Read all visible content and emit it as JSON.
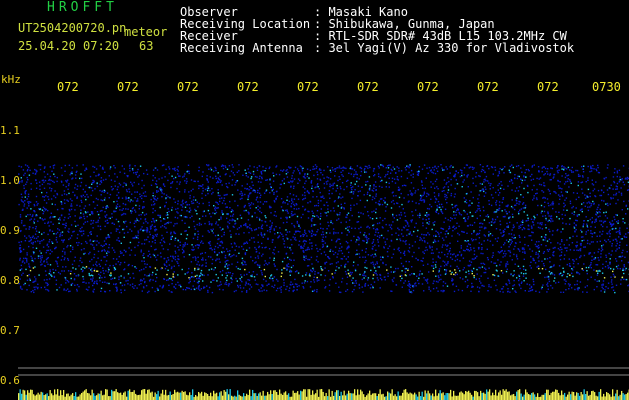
{
  "app": {
    "title": "HROFFT"
  },
  "file": {
    "name": "UT2504200720.pn",
    "event_type": "meteor"
  },
  "timestamp": {
    "date_time": "25.04.20 07:20",
    "count": "63"
  },
  "info": [
    {
      "label": "Observer",
      "value": ": Masaki Kano"
    },
    {
      "label": "Receiving Location",
      "value": ": Shibukawa, Gunma, Japan"
    },
    {
      "label": "Receiver",
      "value": ": RTL-SDR SDR# 43dB L15 103.2MHz CW"
    },
    {
      "label": "Receiving Antenna",
      "value": ": 3el Yagi(V) Az 330 for Vladivostok"
    }
  ],
  "axes": {
    "unit": "kHz",
    "time_ticks": [
      "072",
      "072",
      "072",
      "072",
      "072",
      "072",
      "072",
      "072",
      "072",
      "0730"
    ],
    "freq_ticks": [
      "1.1",
      "1.0",
      "0.9",
      "0.8",
      "0.7",
      "0.6"
    ]
  },
  "colors": {
    "background": "#000000",
    "title": "#22d044",
    "label": "#cfe040",
    "axis": "#e8d020",
    "signal_low": "#0a1ac8",
    "signal_mid": "#1ec8e6",
    "signal_high": "#f0f050"
  }
}
